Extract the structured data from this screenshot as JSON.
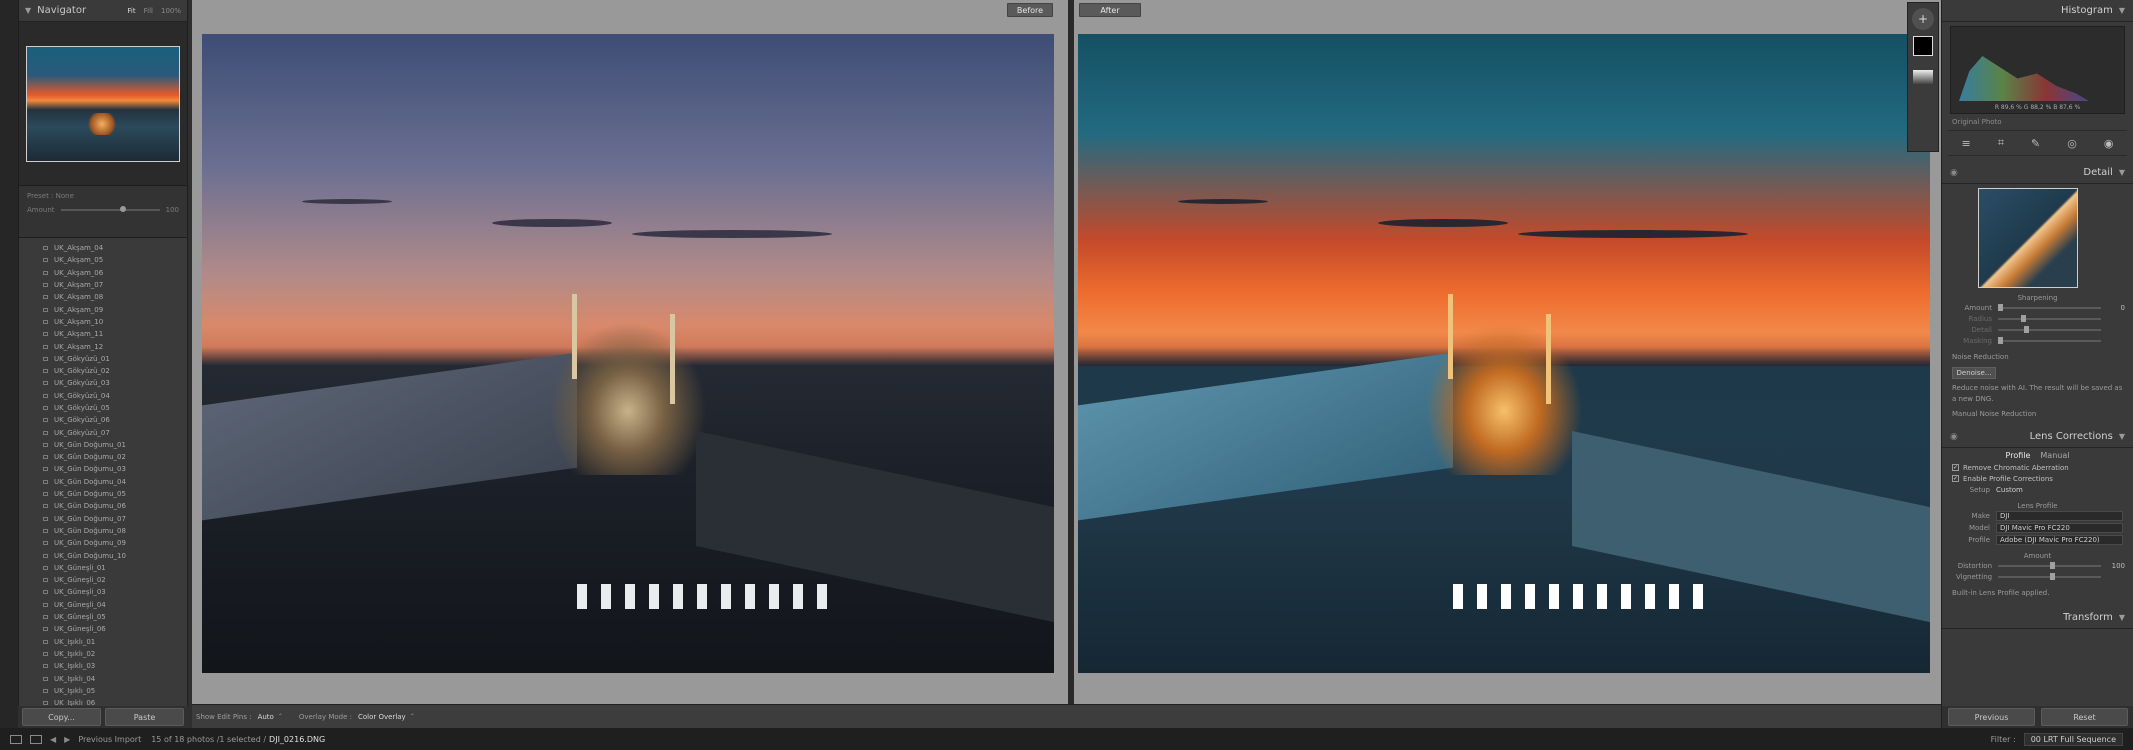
{
  "navigator": {
    "title": "Navigator",
    "zoom_options": [
      "Fit",
      "Fill",
      "100%"
    ],
    "selected_zoom": "Fit"
  },
  "preset": {
    "label": "Preset : None",
    "amount_label": "Amount",
    "amount_value": "100"
  },
  "files": [
    "UK_Akşam_04",
    "UK_Akşam_05",
    "UK_Akşam_06",
    "UK_Akşam_07",
    "UK_Akşam_08",
    "UK_Akşam_09",
    "UK_Akşam_10",
    "UK_Akşam_11",
    "UK_Akşam_12",
    "UK_Gökyüzü_01",
    "UK_Gökyüzü_02",
    "UK_Gökyüzü_03",
    "UK_Gökyüzü_04",
    "UK_Gökyüzü_05",
    "UK_Gökyüzü_06",
    "UK_Gökyüzü_07",
    "UK_Gün Doğumu_01",
    "UK_Gün Doğumu_02",
    "UK_Gün Doğumu_03",
    "UK_Gün Doğumu_04",
    "UK_Gün Doğumu_05",
    "UK_Gün Doğumu_06",
    "UK_Gün Doğumu_07",
    "UK_Gün Doğumu_08",
    "UK_Gün Doğumu_09",
    "UK_Gün Doğumu_10",
    "UK_Güneşli_01",
    "UK_Güneşli_02",
    "UK_Güneşli_03",
    "UK_Güneşli_04",
    "UK_Güneşli_05",
    "UK_Güneşli_06",
    "UK_Işıklı_01",
    "UK_Işıklı_02",
    "UK_Işıklı_03",
    "UK_Işıklı_04",
    "UK_Işıklı_05",
    "UK_Işıklı_06"
  ],
  "left_footer": {
    "copy": "Copy...",
    "paste": "Paste"
  },
  "compare": {
    "before": "Before",
    "after": "After"
  },
  "toolbar": {
    "show_edit_pins_label": "Show Edit Pins :",
    "show_edit_pins_value": "Auto",
    "overlay_mode_label": "Overlay Mode :",
    "overlay_mode_value": "Color Overlay"
  },
  "histogram": {
    "title": "Histogram",
    "readout": "R  89,6 %   G  88,2 %   B  87,6 %",
    "original_photo": "Original Photo"
  },
  "detail": {
    "title": "Detail",
    "sharpening": "Sharpening",
    "rows": [
      {
        "label": "Amount",
        "value": "0",
        "pos": 0.0,
        "dim": false
      },
      {
        "label": "Radius",
        "value": "",
        "pos": 0.22,
        "dim": true
      },
      {
        "label": "Detail",
        "value": "",
        "pos": 0.25,
        "dim": true
      },
      {
        "label": "Masking",
        "value": "",
        "pos": 0.0,
        "dim": true
      }
    ],
    "noise_reduction": "Noise Reduction",
    "denoise": "Denoise...",
    "ai_note": "Reduce noise with AI. The result will be saved as a new DNG.",
    "manual_nr": "Manual Noise Reduction"
  },
  "lens": {
    "title": "Lens Corrections",
    "tabs": [
      "Profile",
      "Manual"
    ],
    "active_tab": "Profile",
    "remove_ca": "Remove Chromatic Aberration",
    "enable_profile": "Enable Profile Corrections",
    "setup_label": "Setup",
    "setup_value": "Custom",
    "lens_profile": "Lens Profile",
    "make_label": "Make",
    "make_value": "DJI",
    "model_label": "Model",
    "model_value": "DJI Mavic Pro FC220",
    "profile_label": "Profile",
    "profile_value": "Adobe (DJI Mavic Pro FC220)",
    "amount": "Amount",
    "distortion_label": "Distortion",
    "distortion_value": "100",
    "vignetting_label": "Vignetting",
    "builtin": "Built-in Lens Profile applied."
  },
  "transform": {
    "title": "Transform"
  },
  "right_footer": {
    "previous": "Previous",
    "reset": "Reset"
  },
  "status": {
    "previous_import": "Previous Import",
    "count": "15 of 18 photos /1 selected /",
    "file": "DJI_0216.DNG",
    "filter_label": "Filter :",
    "filter_value": "00 LRT Full Sequence"
  }
}
